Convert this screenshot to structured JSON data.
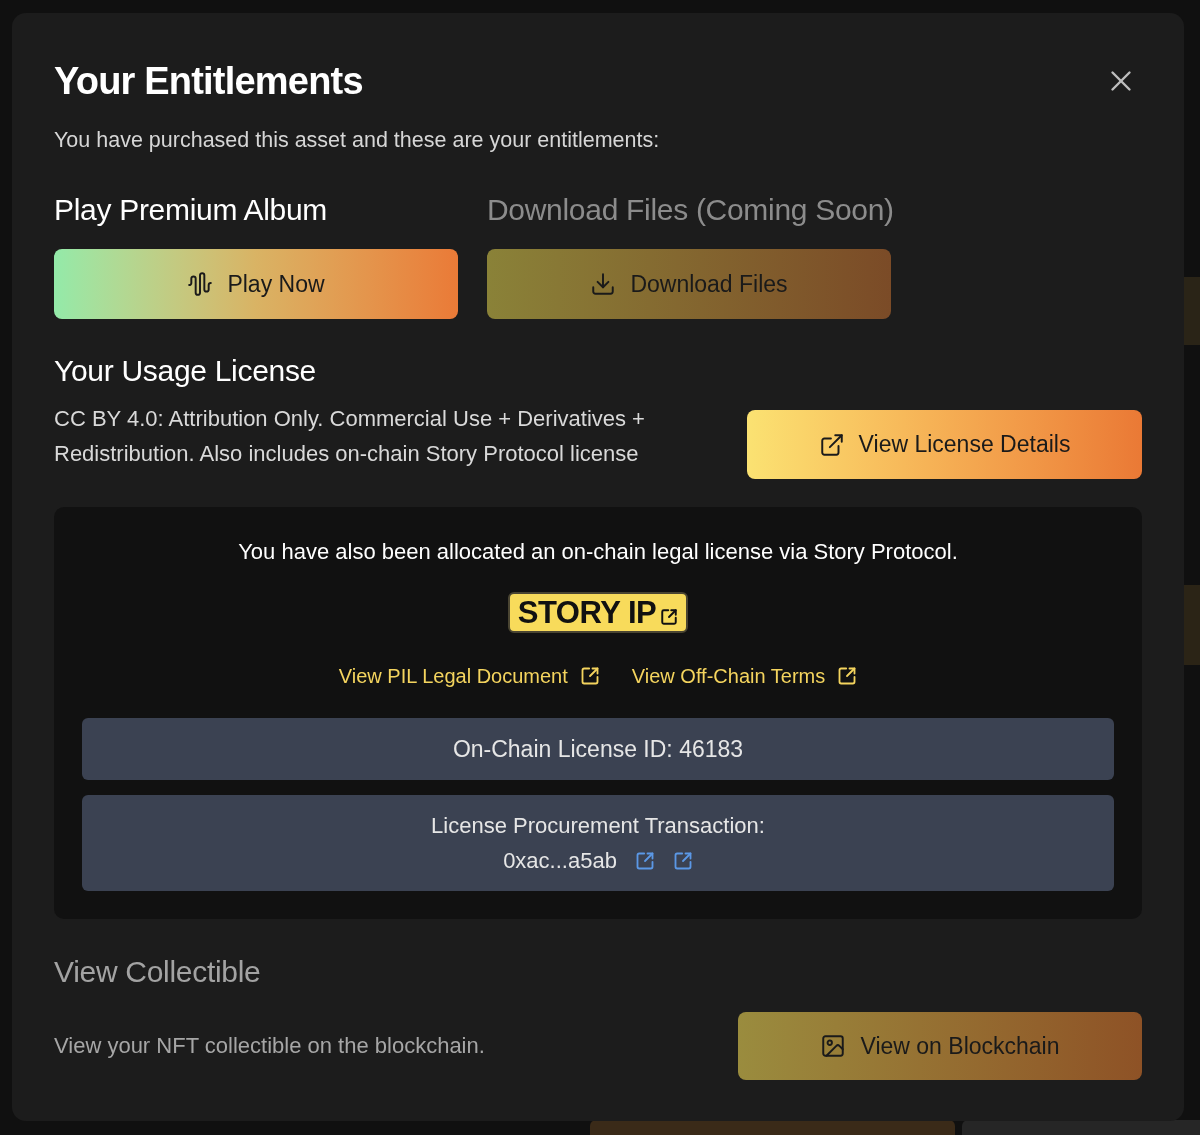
{
  "dialog": {
    "title": "Your Entitlements",
    "subtitle": "You have purchased this asset and these are your entitlements:"
  },
  "entitlements": [
    {
      "kind": "play",
      "heading": "Play Premium Album",
      "button": "Play Now",
      "disabled": false
    },
    {
      "kind": "download",
      "heading": "Download Files (Coming Soon)",
      "button": "Download Files",
      "disabled": true
    }
  ],
  "license": {
    "heading": "Your Usage License",
    "text": "CC BY 4.0: Attribution Only. Commercial Use + Derivatives + Redistribution. Also includes on-chain Story Protocol license",
    "button": "View License Details"
  },
  "story": {
    "notice": "You have also been allocated an on-chain legal license via Story Protocol.",
    "logo": "STORY IP",
    "links": [
      "View PIL Legal Document",
      "View Off-Chain Terms"
    ],
    "license_id": "On-Chain License ID: 46183",
    "transaction_label": "License Procurement Transaction:",
    "transaction_hash": "0xac...a5ab"
  },
  "collectible": {
    "heading": "View Collectible",
    "text": "View your NFT collectible on the blockchain.",
    "button": "View on Blockchain"
  }
}
